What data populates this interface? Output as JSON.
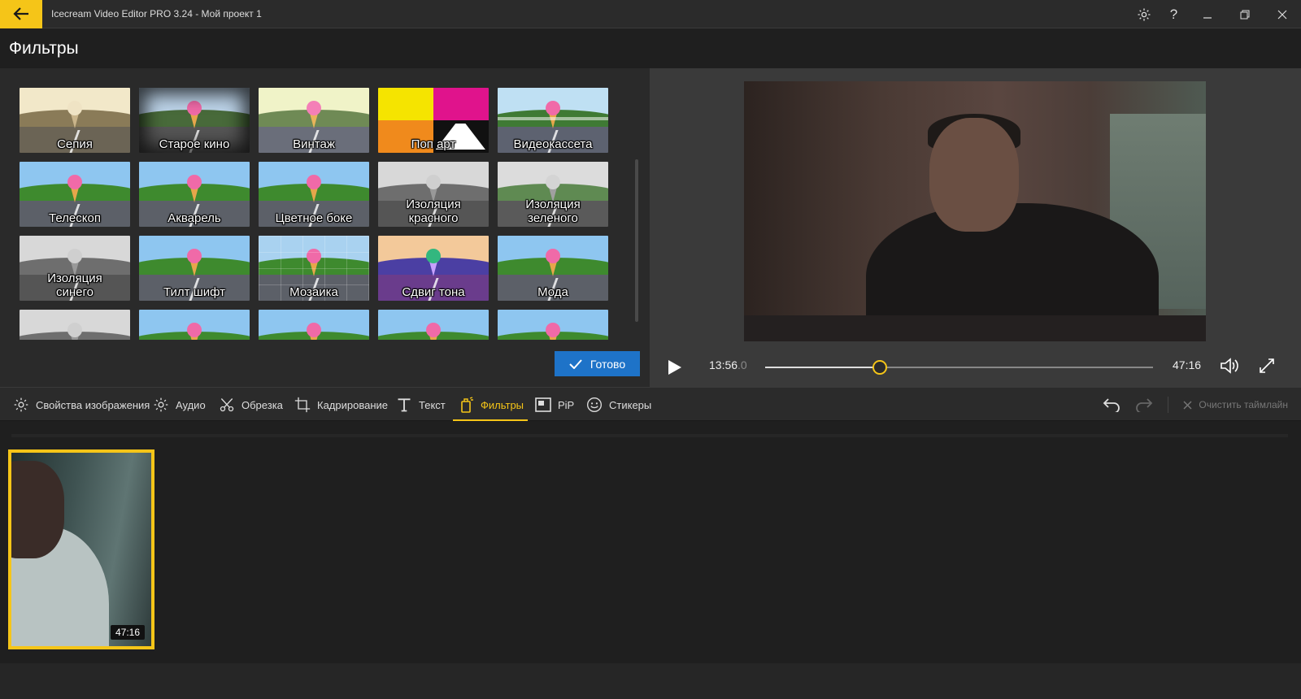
{
  "window": {
    "title": "Icecream Video Editor PRO 3.24   -   Мой проект 1",
    "icons": [
      "back-arrow-icon",
      "gear-icon",
      "help-icon",
      "minimize-icon",
      "restore-icon",
      "close-icon"
    ],
    "help_glyph": "?"
  },
  "page": {
    "title": "Фильтры"
  },
  "filters": [
    {
      "label": "Сепия",
      "style": "sepia"
    },
    {
      "label": "Старое кино",
      "style": "oldfilm"
    },
    {
      "label": "Винтаж",
      "style": "vintage"
    },
    {
      "label": "Поп арт",
      "style": "popart"
    },
    {
      "label": "Видеокассета",
      "style": "vhs"
    },
    {
      "label": "Телескоп",
      "style": "normal"
    },
    {
      "label": "Акварель",
      "style": "normal"
    },
    {
      "label": "Цветное боке",
      "style": "normal"
    },
    {
      "label": "Изоляция красного",
      "style": "gray"
    },
    {
      "label": "Изоляция зеленого",
      "style": "grayish"
    },
    {
      "label": "Изоляция синего",
      "style": "gray"
    },
    {
      "label": "Тилт шифт",
      "style": "normal"
    },
    {
      "label": "Мозаика",
      "style": "mosaic"
    },
    {
      "label": "Сдвиг тона",
      "style": "shift"
    },
    {
      "label": "Мода",
      "style": "normal"
    },
    {
      "label": "",
      "style": "gray"
    },
    {
      "label": "",
      "style": "normal"
    },
    {
      "label": "",
      "style": "normal"
    },
    {
      "label": "",
      "style": "normal"
    },
    {
      "label": "",
      "style": "normal"
    }
  ],
  "done_button": {
    "label": "Готово"
  },
  "player": {
    "current_time": "13:56",
    "current_time_fraction": ".0",
    "total_time": "47:16",
    "progress": 0.295
  },
  "toolbar": {
    "items": [
      {
        "label": "Свойства изображения",
        "icon": "gear-icon",
        "active": false
      },
      {
        "label": "Аудио",
        "icon": "gear-icon",
        "active": false
      },
      {
        "label": "Обрезка",
        "icon": "scissors-icon",
        "active": false
      },
      {
        "label": "Кадрирование",
        "icon": "crop-icon",
        "active": false
      },
      {
        "label": "Текст",
        "icon": "text-icon",
        "active": false
      },
      {
        "label": "Фильтры",
        "icon": "filter-bucket-icon",
        "active": true
      },
      {
        "label": "PiP",
        "icon": "pip-icon",
        "active": false
      },
      {
        "label": "Стикеры",
        "icon": "smiley-icon",
        "active": false
      }
    ],
    "clear_label": "Очистить таймлайн"
  },
  "timeline": {
    "clip_duration": "47:16"
  },
  "colors": {
    "accent": "#f5c518",
    "primary_button": "#1e73c8",
    "background": "#1f1f1f",
    "panel": "#2a2a2a"
  }
}
